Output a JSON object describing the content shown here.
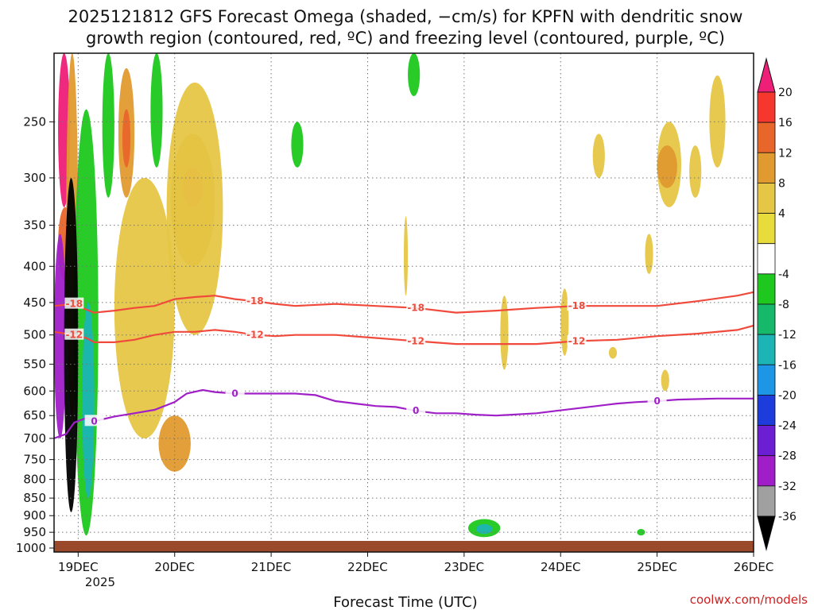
{
  "chart_data": {
    "type": "heatmap",
    "title_line1": "2025121812 GFS Forecast Omega (shaded, −cm/s) for KPFN with dendritic snow",
    "title_line2": "growth region (contoured, red, ºC) and freezing level (contoured, purple, ºC)",
    "xlabel": "Forecast Time (UTC)",
    "credit": "coolwx.com/models",
    "x_ticks": [
      "19DEC",
      "20DEC",
      "21DEC",
      "22DEC",
      "23DEC",
      "24DEC",
      "25DEC",
      "26DEC"
    ],
    "x_year_label": "2025",
    "x_range_hours": [
      0,
      174
    ],
    "y_ticks": [
      "250",
      "300",
      "350",
      "400",
      "450",
      "500",
      "550",
      "600",
      "650",
      "700",
      "750",
      "800",
      "850",
      "900",
      "950",
      "1000"
    ],
    "y_range_hpa": [
      200,
      1013
    ],
    "grid": true,
    "colorbar": {
      "labels": [
        "20",
        "16",
        "12",
        "8",
        "4",
        "-4",
        "-8",
        "-12",
        "-16",
        "-20",
        "-24",
        "-28",
        "-32",
        "-36"
      ],
      "colors": [
        "#ee1f77",
        "#f5372e",
        "#e8662a",
        "#e09a2f",
        "#e5c645",
        "#e8dc3c",
        "#ffffff",
        "#1ec81e",
        "#16b86a",
        "#1cb4b4",
        "#1e96e6",
        "#1e3cdc",
        "#6c1ed2",
        "#a01ec8",
        "#a0a0a0",
        "#000000"
      ]
    },
    "contours": [
      {
        "label": "-18",
        "color": "#f04a3c",
        "points": [
          [
            0,
            455
          ],
          [
            5,
            452
          ],
          [
            7,
            458
          ],
          [
            10,
            465
          ],
          [
            15,
            462
          ],
          [
            20,
            458
          ],
          [
            25,
            455
          ],
          [
            30,
            445
          ],
          [
            35,
            442
          ],
          [
            40,
            440
          ],
          [
            45,
            445
          ],
          [
            50,
            448
          ],
          [
            55,
            452
          ],
          [
            60,
            455
          ],
          [
            70,
            452
          ],
          [
            80,
            455
          ],
          [
            90,
            458
          ],
          [
            100,
            465
          ],
          [
            110,
            462
          ],
          [
            120,
            458
          ],
          [
            130,
            455
          ],
          [
            140,
            455
          ],
          [
            150,
            455
          ],
          [
            160,
            448
          ],
          [
            170,
            440
          ],
          [
            174,
            435
          ]
        ]
      },
      {
        "label": "-12",
        "color": "#f04a3c",
        "points": [
          [
            0,
            495
          ],
          [
            5,
            500
          ],
          [
            8,
            505
          ],
          [
            10,
            512
          ],
          [
            15,
            512
          ],
          [
            20,
            508
          ],
          [
            25,
            500
          ],
          [
            30,
            495
          ],
          [
            35,
            495
          ],
          [
            40,
            492
          ],
          [
            45,
            495
          ],
          [
            50,
            500
          ],
          [
            55,
            502
          ],
          [
            60,
            500
          ],
          [
            70,
            500
          ],
          [
            80,
            505
          ],
          [
            90,
            510
          ],
          [
            100,
            515
          ],
          [
            110,
            515
          ],
          [
            120,
            515
          ],
          [
            130,
            510
          ],
          [
            140,
            508
          ],
          [
            150,
            502
          ],
          [
            160,
            498
          ],
          [
            170,
            492
          ],
          [
            174,
            485
          ]
        ]
      },
      {
        "label": "0",
        "color": "#a020c8",
        "points": [
          [
            0,
            700
          ],
          [
            3,
            690
          ],
          [
            5,
            665
          ],
          [
            8,
            655
          ],
          [
            10,
            662
          ],
          [
            15,
            652
          ],
          [
            20,
            645
          ],
          [
            25,
            638
          ],
          [
            30,
            622
          ],
          [
            33,
            605
          ],
          [
            37,
            598
          ],
          [
            40,
            602
          ],
          [
            45,
            605
          ],
          [
            50,
            605
          ],
          [
            55,
            605
          ],
          [
            60,
            605
          ],
          [
            65,
            608
          ],
          [
            70,
            620
          ],
          [
            75,
            625
          ],
          [
            80,
            630
          ],
          [
            85,
            632
          ],
          [
            90,
            640
          ],
          [
            95,
            645
          ],
          [
            100,
            645
          ],
          [
            105,
            648
          ],
          [
            110,
            650
          ],
          [
            120,
            645
          ],
          [
            125,
            640
          ],
          [
            130,
            635
          ],
          [
            135,
            630
          ],
          [
            140,
            625
          ],
          [
            145,
            622
          ],
          [
            150,
            620
          ],
          [
            155,
            617
          ],
          [
            165,
            615
          ],
          [
            174,
            615
          ]
        ]
      }
    ],
    "shaded_regions": [
      {
        "value": 20,
        "x": [
          1,
          4
        ],
        "p": [
          200,
          330
        ]
      },
      {
        "value": 12,
        "x": [
          1,
          4.5
        ],
        "p": [
          330,
          420
        ]
      },
      {
        "value": 8,
        "x": [
          3,
          6
        ],
        "p": [
          200,
          650
        ]
      },
      {
        "value": 8,
        "x": [
          16,
          20
        ],
        "p": [
          210,
          320
        ]
      },
      {
        "value": 12,
        "x": [
          17,
          19
        ],
        "p": [
          240,
          290
        ]
      },
      {
        "value": 8,
        "x": [
          29,
          40
        ],
        "p": [
          260,
          400
        ]
      },
      {
        "value": 16,
        "x": [
          32,
          37
        ],
        "p": [
          290,
          330
        ]
      },
      {
        "value": 4,
        "x": [
          28,
          42
        ],
        "p": [
          220,
          500
        ]
      },
      {
        "value": 4,
        "x": [
          15,
          30
        ],
        "p": [
          300,
          700
        ]
      },
      {
        "value": 8,
        "x": [
          26,
          34
        ],
        "p": [
          650,
          780
        ]
      },
      {
        "value": 4,
        "x": [
          150,
          156
        ],
        "p": [
          250,
          330
        ]
      },
      {
        "value": 8,
        "x": [
          150,
          155
        ],
        "p": [
          270,
          310
        ]
      },
      {
        "value": 4,
        "x": [
          158,
          161
        ],
        "p": [
          270,
          320
        ]
      },
      {
        "value": 4,
        "x": [
          163,
          167
        ],
        "p": [
          215,
          290
        ]
      },
      {
        "value": 4,
        "x": [
          134,
          137
        ],
        "p": [
          260,
          300
        ]
      },
      {
        "value": 4,
        "x": [
          147,
          149
        ],
        "p": [
          360,
          410
        ]
      },
      {
        "value": 4,
        "x": [
          126,
          128
        ],
        "p": [
          430,
          535
        ]
      },
      {
        "value": 4,
        "x": [
          138,
          140
        ],
        "p": [
          520,
          540
        ]
      },
      {
        "value": 4,
        "x": [
          151,
          153
        ],
        "p": [
          560,
          600
        ]
      },
      {
        "value": 4,
        "x": [
          87,
          88
        ],
        "p": [
          340,
          440
        ]
      },
      {
        "value": 4,
        "x": [
          111,
          113
        ],
        "p": [
          440,
          560
        ]
      },
      {
        "value": -8,
        "x": [
          5,
          11
        ],
        "p": [
          240,
          960
        ]
      },
      {
        "value": -16,
        "x": [
          7,
          10
        ],
        "p": [
          450,
          850
        ]
      },
      {
        "value": -8,
        "x": [
          12,
          15
        ],
        "p": [
          200,
          320
        ]
      },
      {
        "value": -8,
        "x": [
          24,
          27
        ],
        "p": [
          200,
          290
        ]
      },
      {
        "value": -8,
        "x": [
          59,
          62
        ],
        "p": [
          250,
          290
        ]
      },
      {
        "value": -8,
        "x": [
          88,
          91
        ],
        "p": [
          200,
          230
        ]
      },
      {
        "value": -8,
        "x": [
          103,
          111
        ],
        "p": [
          910,
          965
        ]
      },
      {
        "value": -16,
        "x": [
          105,
          109
        ],
        "p": [
          925,
          955
        ]
      },
      {
        "value": -8,
        "x": [
          145,
          147
        ],
        "p": [
          940,
          960
        ]
      },
      {
        "value": -28,
        "x": [
          0,
          3
        ],
        "p": [
          360,
          700
        ]
      },
      {
        "value": -36,
        "x": [
          2.5,
          6
        ],
        "p": [
          300,
          890
        ]
      }
    ]
  }
}
